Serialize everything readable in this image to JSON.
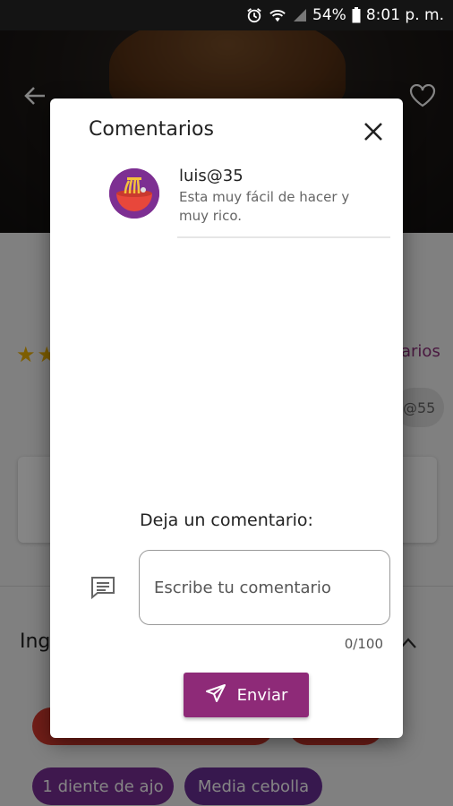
{
  "status_bar": {
    "battery": "54%",
    "time": "8:01 p. m."
  },
  "background": {
    "comments_link": "arios",
    "author_chip": "@55",
    "ingredients_title": "Ingredientes",
    "chips": [
      "",
      "",
      "1 diente de ajo",
      "Media cebolla"
    ]
  },
  "dialog": {
    "title": "Comentarios",
    "comments": [
      {
        "user": "luis@35",
        "text": "Esta muy fácil de hacer y muy rico."
      }
    ],
    "leave_comment_label": "Deja un comentario:",
    "input_placeholder": "Escribe tu comentario",
    "counter": "0/100",
    "send_label": "Enviar"
  },
  "colors": {
    "accent": "#8e2a78",
    "chip_red": "#d93a2f",
    "chip_purple": "#7a2f96",
    "star": "#f2b400"
  }
}
